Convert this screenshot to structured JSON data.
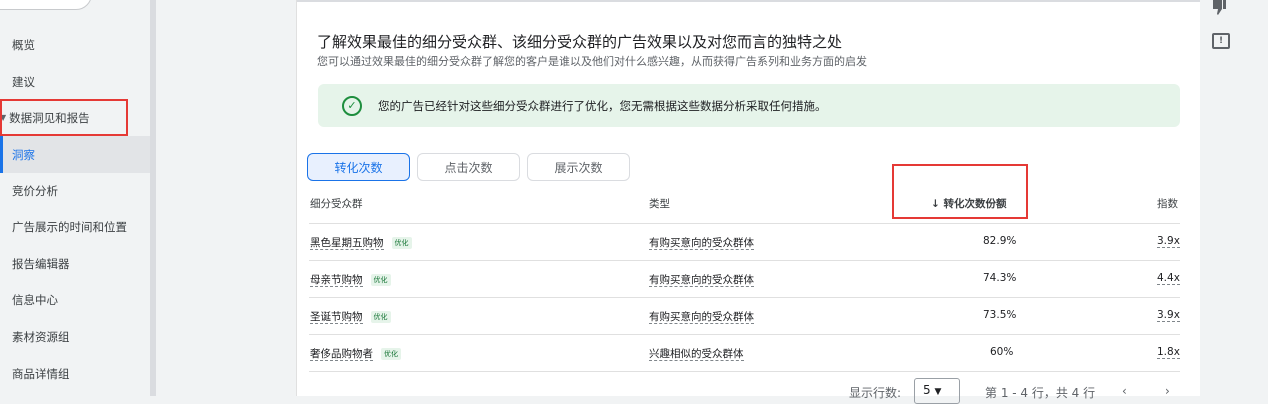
{
  "sidebar": {
    "items": [
      {
        "label": "概览"
      },
      {
        "label": "建议"
      },
      {
        "label": "数据洞见和报告"
      },
      {
        "label": "洞察"
      },
      {
        "label": "竞价分析"
      },
      {
        "label": "广告展示的时间和位置"
      },
      {
        "label": "报告编辑器"
      },
      {
        "label": "信息中心"
      },
      {
        "label": "素材资源组"
      },
      {
        "label": "商品详情组"
      }
    ]
  },
  "card": {
    "title": "了解效果最佳的细分受众群、该细分受众群的广告效果以及对您而言的独特之处",
    "subtitle": "您可以通过效果最佳的细分受众群了解您的客户是谁以及他们对什么感兴趣，从而获得广告系列和业务方面的启发",
    "banner_text": "您的广告已经针对这些细分受众群进行了优化，您无需根据这些数据分析采取任何措施。",
    "tabs": [
      {
        "label": "转化次数"
      },
      {
        "label": "点击次数"
      },
      {
        "label": "展示次数"
      }
    ],
    "table": {
      "headers": {
        "segment": "细分受众群",
        "type": "类型",
        "share": "转化次数份额",
        "index": "指数"
      },
      "rows": [
        {
          "segment": "黑色星期五购物",
          "badge": "优化",
          "type": "有购买意向的受众群体",
          "share": "82.9%",
          "index": "3.9x"
        },
        {
          "segment": "母亲节购物",
          "badge": "优化",
          "type": "有购买意向的受众群体",
          "share": "74.3%",
          "index": "4.4x"
        },
        {
          "segment": "圣诞节购物",
          "badge": "优化",
          "type": "有购买意向的受众群体",
          "share": "73.5%",
          "index": "3.9x"
        },
        {
          "segment": "奢侈品购物者",
          "badge": "优化",
          "type": "兴趣相似的受众群体",
          "share": "60%",
          "index": "1.8x"
        }
      ]
    },
    "footer": {
      "rows_label": "显示行数:",
      "rows_value": "5",
      "range": "第 1 - 4 行，共 4 行"
    }
  },
  "colors": {
    "accent": "#1a73e8",
    "success": "#1e8e3e",
    "highlight": "#e53935"
  },
  "icons": {
    "sort": "arrow-down-icon",
    "check": "check-circle-icon",
    "feedback": "feedback-icon",
    "thumb": "thumb-down-icon"
  }
}
